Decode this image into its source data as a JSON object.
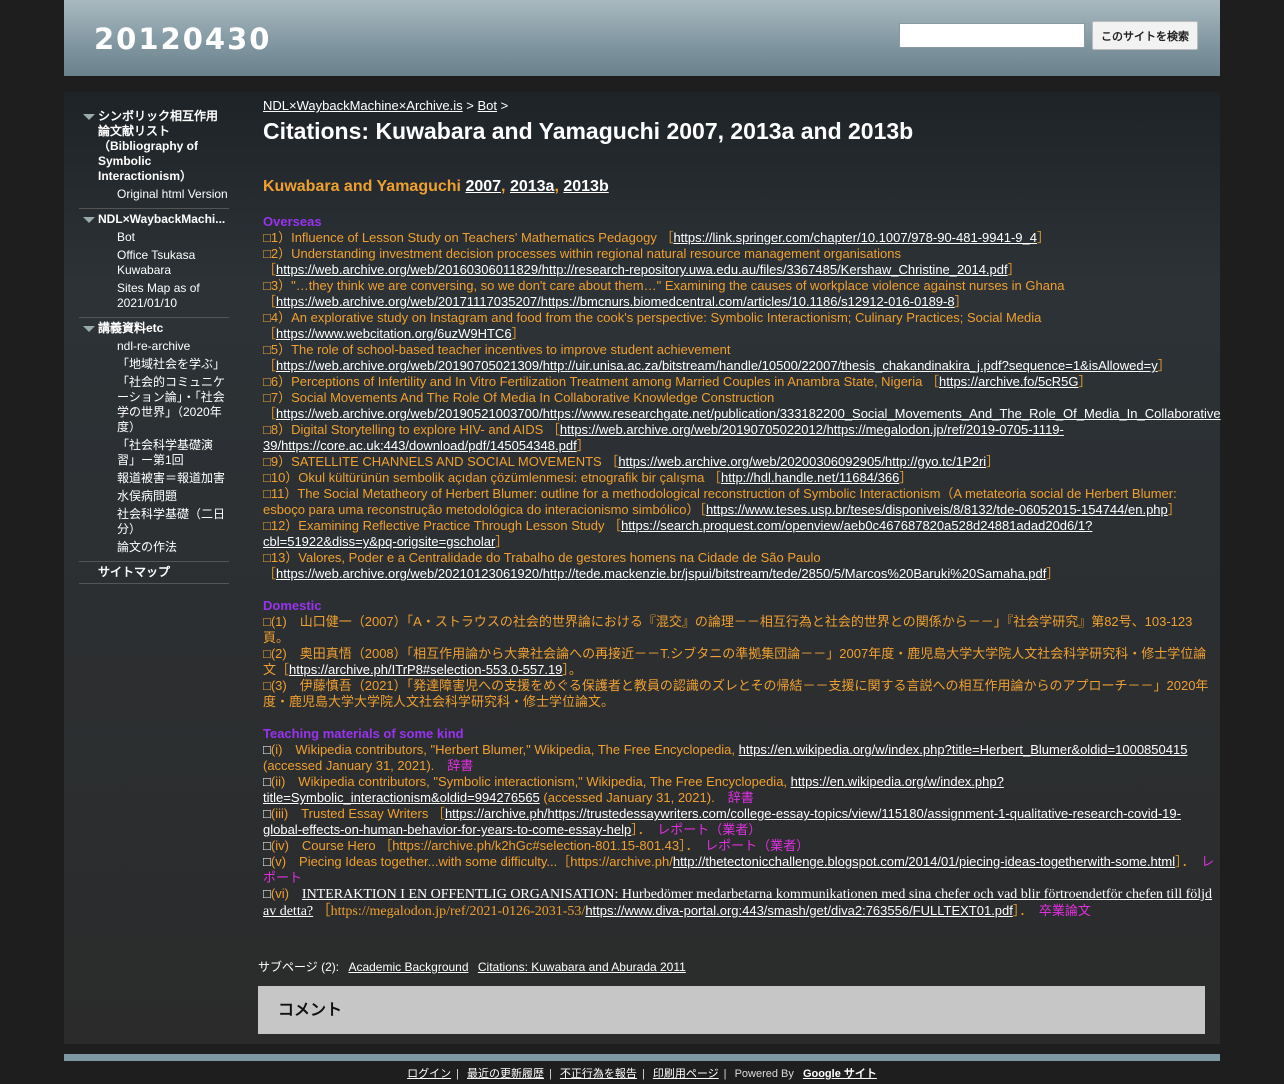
{
  "site": {
    "title": "20120430",
    "search_button": "このサイトを検索",
    "search_value": ""
  },
  "sidebar": {
    "groups": [
      {
        "label": "シンボリック相互作用論文献リスト（Bibliography of Symbolic Interactionism）",
        "items": [
          "Original html Version"
        ]
      },
      {
        "label": "NDL×WaybackMachi...",
        "items": [
          "Bot",
          "Office Tsukasa Kuwabara",
          "Sites Map as of 2021/01/10"
        ]
      },
      {
        "label": "講義資料etc",
        "items": [
          "ndl-re-archive",
          "「地域社会を学ぶ」",
          "「社会的コミュニケーション論」・「社会学の世界」（2020年度）",
          "「社会科学基礎演習」ー第1回",
          "報道被害＝報道加害",
          "水俣病問題",
          "社会科学基礎（二日分）",
          "論文の作法"
        ]
      },
      {
        "label": "サイトマップ",
        "items": []
      }
    ]
  },
  "breadcrumb": {
    "first": "NDL×WaybackMachine×Archive.is",
    "sep1": ">",
    "second": "Bot",
    "sep2": ">"
  },
  "page_title": "Citations: Kuwabara and Yamaguchi 2007, 2013a and 2013b",
  "heading": {
    "text": "Kuwabara and Yamaguchi",
    "y2007": "2007",
    "comma1": ",",
    "y2013a": "2013a",
    "comma2": ",",
    "y2013b": "2013b"
  },
  "sections": {
    "overseas": "Overseas",
    "domestic": "Domestic",
    "teaching": "Teaching materials of some kind"
  },
  "overseas": [
    {
      "text": "□1）Influence of Lesson Study on Teachers' Mathematics Pedagogy ［",
      "link": "https://link.springer.com/chapter/10.1007/978-90-481-9941-9_4",
      "tail": "］"
    },
    {
      "text": "□2）Understanding investment decision processes within regional natural resource management organisations ［",
      "link": "https://web.archive.org/web/20160306011829/http://research-repository.uwa.edu.au/files/3367485/Kershaw_Christine_2014.pdf",
      "tail": "］"
    },
    {
      "text": "□3）\"…they think we are conversing, so we don't care about them…\" Examining the causes of workplace violence against nurses in Ghana ［",
      "link": "https://web.archive.org/web/20171117035207/https://bmcnurs.biomedcentral.com/articles/10.1186/s12912-016-0189-8",
      "tail": "］"
    },
    {
      "text": "□4）An explorative study on Instagram and food from the cook's perspective: Symbolic Interactionism; Culinary Practices; Social Media ［",
      "link": "https://www.webcitation.org/6uzW9HTC6",
      "tail": "］"
    },
    {
      "text": "□5）The role of school-based teacher incentives to improve student achievement ［",
      "link": "https://web.archive.org/web/20190705021309/http://uir.unisa.ac.za/bitstream/handle/10500/22007/thesis_chakandinakira_j.pdf?sequence=1&isAllowed=y",
      "tail": "］"
    },
    {
      "text": "□6）Perceptions of Infertility and In Vitro Fertilization Treatment among Married Couples in Anambra State, Nigeria ［",
      "link": "https://archive.fo/5cR5G",
      "tail": "］"
    },
    {
      "text": "□7）Social Movements And The Role Of Media In Collaborative Knowledge Construction ［",
      "link": "https://web.archive.org/web/20190521003700/https://www.researchgate.net/publication/333182200_Social_Movements_And_The_Role_Of_Media_In_Collaborative",
      "tail": ""
    },
    {
      "text": "□8）Digital Storytelling to explore HIV- and AIDS ［",
      "link": "https://web.archive.org/web/20190705022012/https://megalodon.jp/ref/2019-0705-1119-39/https://core.ac.uk:443/download/pdf/145054348.pdf",
      "tail": "］"
    },
    {
      "text": "□9）SATELLITE CHANNELS AND SOCIAL MOVEMENTS ［",
      "link": "https://web.archive.org/web/20200306092905/http://gyo.tc/1P2ri",
      "tail": "］"
    },
    {
      "text": "□10）Okul kültürünün sembolik açıdan çözümlenmesi: etnografik bir çalışma ［",
      "link": "http://hdl.handle.net/11684/366",
      "tail": "］"
    },
    {
      "text": "□11）The Social Metatheory of Herbert Blumer: outline for a methodological reconstruction of Symbolic Interactionism（A metateoria social de Herbert Blumer: esboço para uma reconstrução metodológica do interacionismo simbólico）［",
      "link": "https://www.teses.usp.br/teses/disponiveis/8/8132/tde-06052015-154744/en.php",
      "tail": "］"
    },
    {
      "text": "□12）Examining Reflective Practice Through Lesson Study ［",
      "link": "https://search.proquest.com/openview/aeb0c467687820a528d24881adad20d6/1?cbl=51922&diss=y&pq-origsite=gscholar",
      "tail": "］"
    },
    {
      "text": "□13）Valores, Poder e a Centralidade do Trabalho de gestores homens na Cidade de São Paulo ［",
      "link": "https://web.archive.org/web/20210123061920/http://tede.mackenzie.br/jspui/bitstream/tede/2850/5/Marcos%20Baruki%20Samaha.pdf",
      "tail": "］"
    }
  ],
  "domestic": [
    {
      "text": "□(1)　山口健一（2007）「A・ストラウスの社会的世界論における『混交』の論理－－相互行為と社会的世界との関係から－－」『社会学研究』第82号、103-123頁。",
      "link": "",
      "tail": ""
    },
    {
      "text": "□(2)　奥田真悟（2008）「相互作用論から大衆社会論への再接近－－T.シブタニの準拠集団論－－」2007年度・鹿児島大学大学院人文社会科学研究科・修士学位論文［",
      "link": "https://archive.ph/ITrP8#selection-553.0-557.19",
      "tail": "］。"
    },
    {
      "text": "□(3)　伊藤慎吾（2021）「発達障害児への支援をめぐる保護者と教員の認識のズレとその帰結－－支援に関する言説への相互作用論からのアプローチ－－」2020年度・鹿児島大学大学院人文社会科学研究科・修士学位論文。",
      "link": "",
      "tail": ""
    }
  ],
  "teaching": [
    {
      "mark": "□",
      "label": "(i)　Wikipedia contributors, \"Herbert Blumer,\" Wikipedia, The Free Encyclopedia, ",
      "link": "https://en.wikipedia.org/w/index.php?title=Herbert_Blumer&oldid=1000850415",
      "tail": " (accessed January 31, 2021).　",
      "tag": "辞書"
    },
    {
      "mark": "□",
      "label": "(ii)　Wikipedia contributors, \"Symbolic interactionism,\" Wikipedia, The Free Encyclopedia, ",
      "link": "https://en.wikipedia.org/w/index.php?title=Symbolic_interactionism&oldid=994276565",
      "tail": " (accessed January 31, 2021).　",
      "tag": "辞書"
    },
    {
      "mark": "□",
      "label": "(iii)　Trusted Essay Writers ［",
      "link": "https://archive.ph/https://trustedessaywriters.com/college-essay-topics/view/115180/assignment-1-qualitative-research-covid-19-global-effects-on-human-behavior-for-years-to-come-essay-help",
      "tail": "］．　",
      "tag": "レポート（業者）"
    },
    {
      "mark": "□",
      "label": "(iv)　Course Hero ［https://archive.ph/k2hGc#selection-801.15-801.43］．　",
      "link": "",
      "tail": "",
      "tag": "レポート（業者）"
    },
    {
      "mark": "□",
      "label": "(v)　Piecing Ideas together...with some difficulty...［https://archive.ph/",
      "link": "http://thetectonicchallenge.blogspot.com/2014/01/piecing-ideas-togetherwith-some.html",
      "tail": "］．　",
      "tag": "レポート"
    },
    {
      "mark": "□",
      "label": "(vi)　",
      "title_link": "INTERAKTION I EN OFFENTLIG ORGANISATION: Hurbedömer medarbetarna kommunikationen med sina chefer och vad blir förtroendetför chefen till följd av detta?",
      "mid": " ［https://megalodon.jp/ref/2021-0126-2031-53/",
      "link": "https://www.diva-portal.org:443/smash/get/diva2:763556/FULLTEXT01.pdf",
      "tail": "］．　",
      "tag": "卒業論文"
    }
  ],
  "subpages": {
    "label": "サブページ (2):",
    "a": "Academic Background",
    "b": "Citations: Kuwabara and Aburada 2011"
  },
  "comment": "コメント",
  "footer": {
    "login": "ログイン",
    "recent": "最近の更新履歴",
    "abuse": "不正行為を報告",
    "print": "印刷用ページ",
    "powered": "Powered By",
    "google": "Google サイト",
    "sep": "|"
  }
}
